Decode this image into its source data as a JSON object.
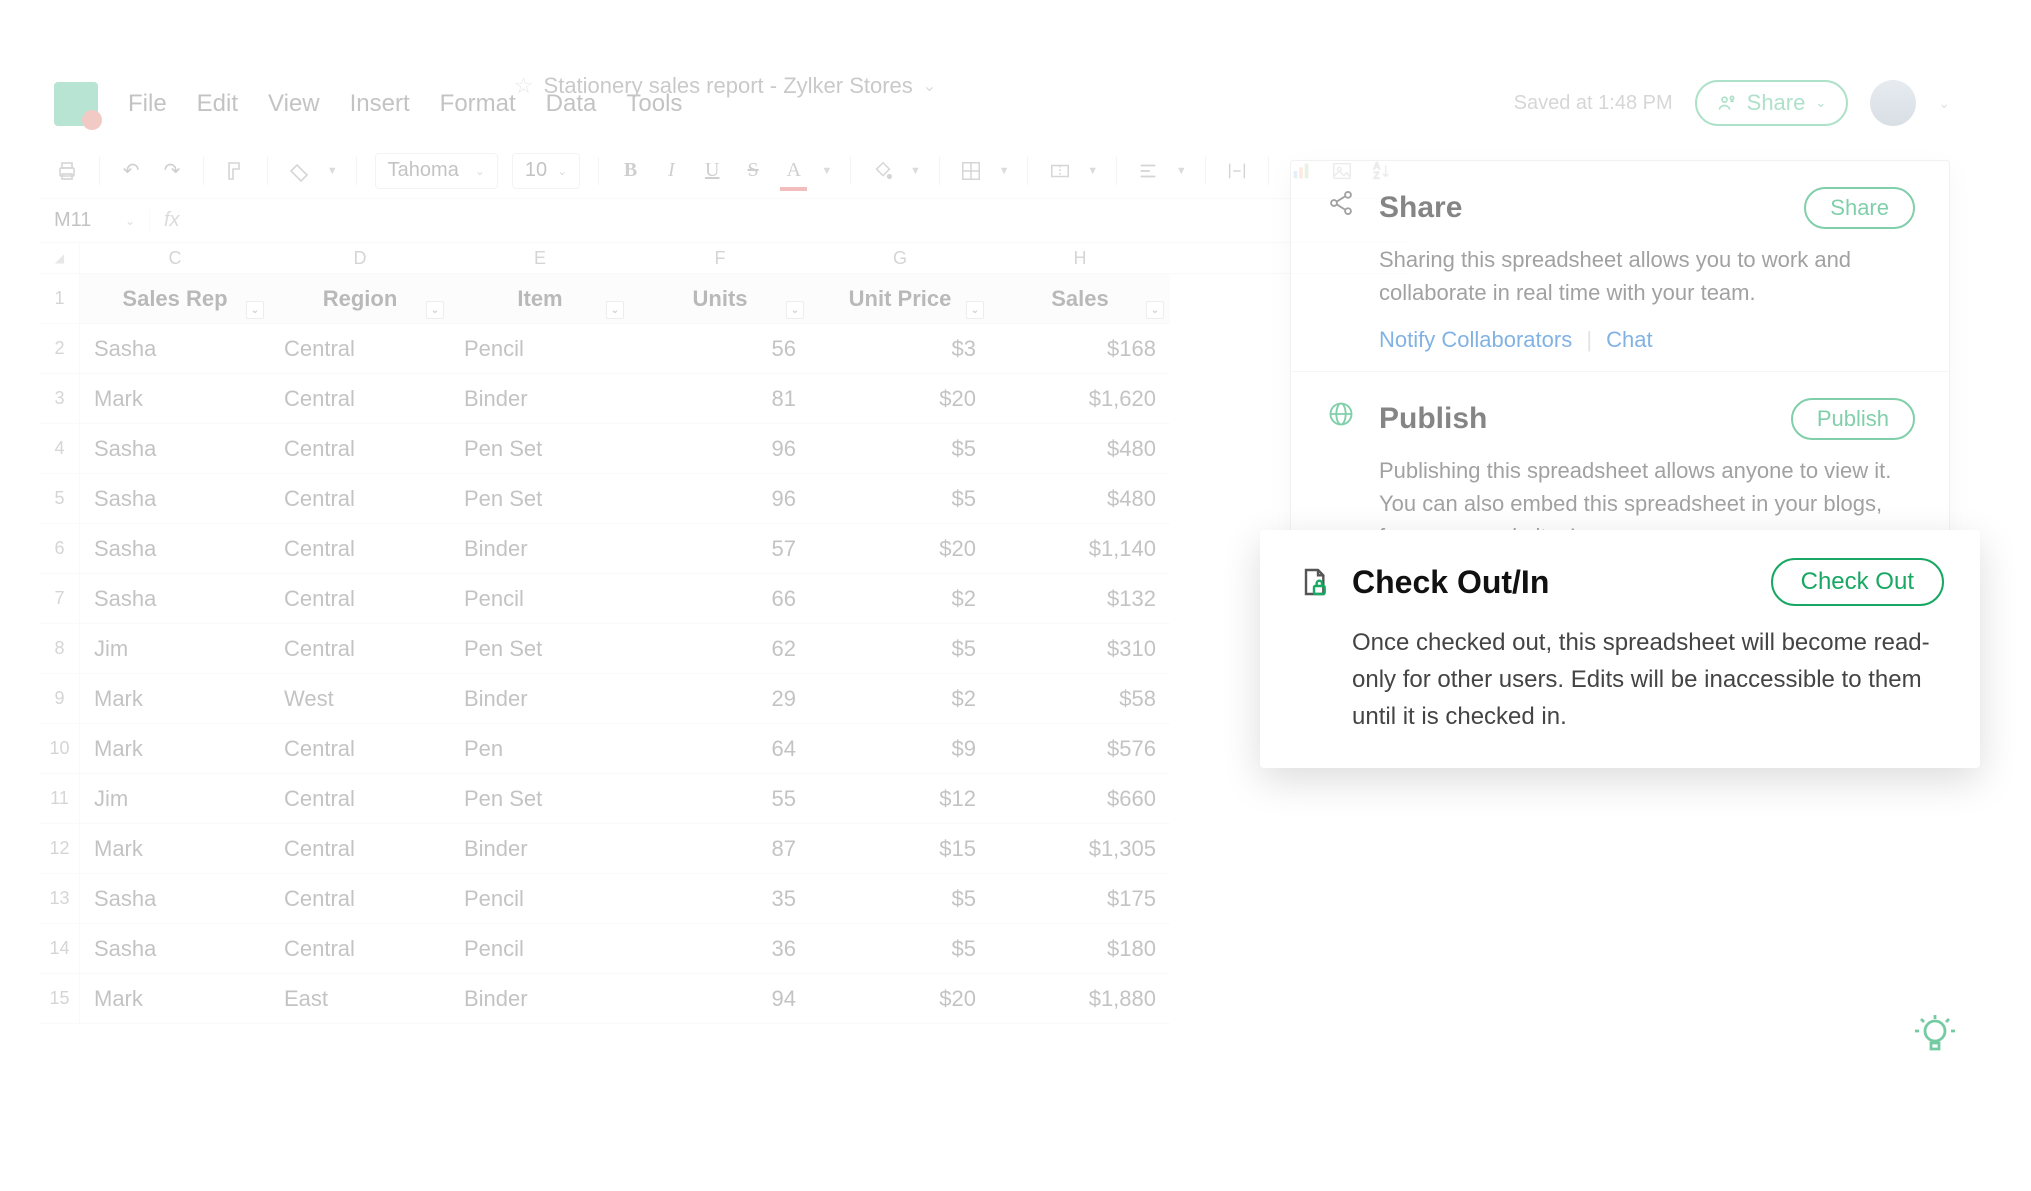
{
  "header": {
    "doc_title": "Stationery sales report - Zylker Stores",
    "saved_status": "Saved at 1:48 PM",
    "share_button": "Share",
    "menu": [
      "File",
      "Edit",
      "View",
      "Insert",
      "Format",
      "Data",
      "Tools"
    ]
  },
  "toolbar": {
    "font_family": "Tahoma",
    "font_size": "10",
    "bold": "B",
    "italic": "I",
    "underline": "U",
    "strike": "S",
    "text_color": "A"
  },
  "formula_bar": {
    "cell_ref": "M11",
    "fx": "fx"
  },
  "sheet": {
    "column_letters": [
      "C",
      "D",
      "E",
      "F",
      "G",
      "H"
    ],
    "headers": [
      "Sales Rep",
      "Region",
      "Item",
      "Units",
      "Unit Price",
      "Sales"
    ],
    "rows": [
      {
        "n": "2",
        "rep": "Sasha",
        "region": "Central",
        "item": "Pencil",
        "units": "56",
        "price": "$3",
        "sales": "$168"
      },
      {
        "n": "3",
        "rep": "Mark",
        "region": "Central",
        "item": "Binder",
        "units": "81",
        "price": "$20",
        "sales": "$1,620"
      },
      {
        "n": "4",
        "rep": "Sasha",
        "region": "Central",
        "item": "Pen Set",
        "units": "96",
        "price": "$5",
        "sales": "$480"
      },
      {
        "n": "5",
        "rep": "Sasha",
        "region": "Central",
        "item": "Pen Set",
        "units": "96",
        "price": "$5",
        "sales": "$480"
      },
      {
        "n": "6",
        "rep": "Sasha",
        "region": "Central",
        "item": "Binder",
        "units": "57",
        "price": "$20",
        "sales": "$1,140"
      },
      {
        "n": "7",
        "rep": "Sasha",
        "region": "Central",
        "item": "Pencil",
        "units": "66",
        "price": "$2",
        "sales": "$132"
      },
      {
        "n": "8",
        "rep": "Jim",
        "region": "Central",
        "item": "Pen Set",
        "units": "62",
        "price": "$5",
        "sales": "$310"
      },
      {
        "n": "9",
        "rep": "Mark",
        "region": "West",
        "item": "Binder",
        "units": "29",
        "price": "$2",
        "sales": "$58"
      },
      {
        "n": "10",
        "rep": "Mark",
        "region": "Central",
        "item": "Pen",
        "units": "64",
        "price": "$9",
        "sales": "$576"
      },
      {
        "n": "11",
        "rep": "Jim",
        "region": "Central",
        "item": "Pen Set",
        "units": "55",
        "price": "$12",
        "sales": "$660"
      },
      {
        "n": "12",
        "rep": "Mark",
        "region": "Central",
        "item": "Binder",
        "units": "87",
        "price": "$15",
        "sales": "$1,305"
      },
      {
        "n": "13",
        "rep": "Sasha",
        "region": "Central",
        "item": "Pencil",
        "units": "35",
        "price": "$5",
        "sales": "$175"
      },
      {
        "n": "14",
        "rep": "Sasha",
        "region": "Central",
        "item": "Pencil",
        "units": "36",
        "price": "$5",
        "sales": "$180"
      },
      {
        "n": "15",
        "rep": "Mark",
        "region": "East",
        "item": "Binder",
        "units": "94",
        "price": "$20",
        "sales": "$1,880"
      }
    ]
  },
  "share_panel": {
    "share": {
      "title": "Share",
      "button": "Share",
      "desc": "Sharing this spreadsheet allows you to work and collaborate in real time with your team.",
      "link_notify": "Notify Collaborators",
      "link_chat": "Chat"
    },
    "publish": {
      "title": "Publish",
      "button": "Publish",
      "desc": "Publishing this spreadsheet allows anyone to view it. You can also embed this spreadsheet in your blogs, forums, or websites!"
    }
  },
  "checkout_card": {
    "title": "Check Out/In",
    "button": "Check Out",
    "desc": "Once checked out, this spreadsheet will become read-only for other users. Edits will be inaccessible to them until it is checked in."
  }
}
